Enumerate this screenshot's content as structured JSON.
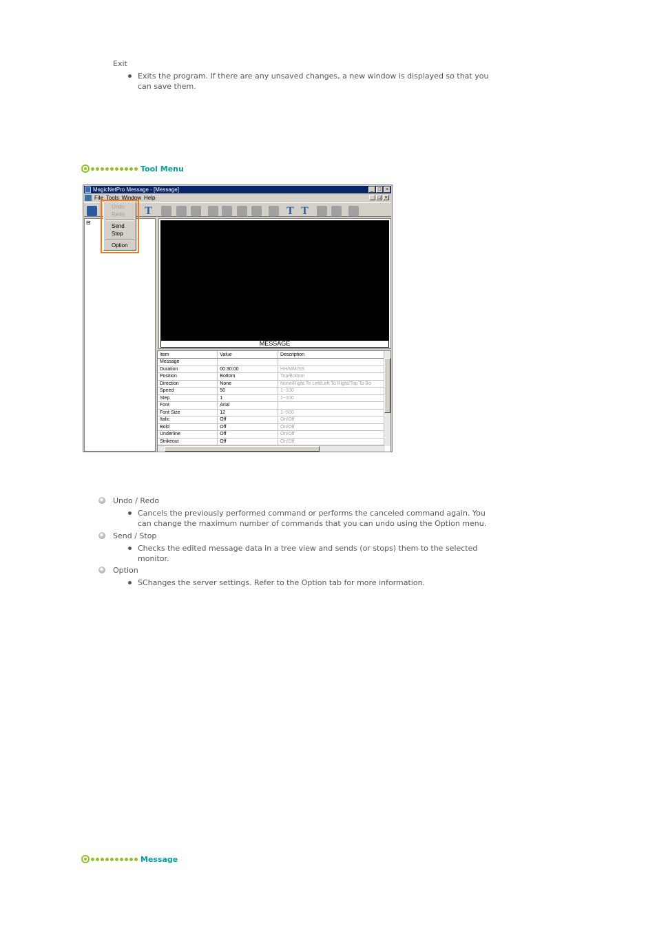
{
  "exit": {
    "term": "Exit",
    "description": "Exits the program. If there are any unsaved changes, a new window is displayed so that you can save them."
  },
  "sections": {
    "tool_menu": "Tool Menu",
    "message": "Message"
  },
  "screenshot": {
    "window_title": "MagicNetPro Message - [Message]",
    "menu": [
      "File",
      "Tools",
      "Window",
      "Help"
    ],
    "tools_dropdown": [
      "Undo",
      "Redo",
      "Send",
      "Stop",
      "Option"
    ],
    "preview_label": "MESSAGE",
    "grid_headers": [
      "Item",
      "Value",
      "Description"
    ],
    "grid_rows": [
      [
        "Message",
        "",
        ""
      ],
      [
        "Duration",
        "00:30:00",
        "HH/MM/SS"
      ],
      [
        "Position",
        "Bottom",
        "Top/Bottom"
      ],
      [
        "Direction",
        "None",
        "None/Right To Left/Left To Right/Top To Bo"
      ],
      [
        "Speed",
        "50",
        "1~100"
      ],
      [
        "Step",
        "1",
        "1~100"
      ],
      [
        "Font",
        "Arial",
        ""
      ],
      [
        "Font Size",
        "12",
        "1~500"
      ],
      [
        "Italic",
        "Off",
        "On/Off"
      ],
      [
        "Bold",
        "Off",
        "On/Off"
      ],
      [
        "Underline",
        "Off",
        "On/Off"
      ],
      [
        "Strikeout",
        "Off",
        "On/Off"
      ]
    ]
  },
  "items": [
    {
      "term": "Undo / Redo",
      "description": "Cancels the previously performed command or performs the canceled command again. You can change the maximum number of commands that you can undo using the Option menu."
    },
    {
      "term": "Send / Stop",
      "description": "Checks the edited message data in a tree view and sends (or stops) them to the selected monitor."
    },
    {
      "term": "Option",
      "description": "SChanges the server settings. Refer to the Option tab for more information."
    }
  ],
  "colors": {
    "section_title": "#00a398",
    "section_dots": "#8dc21f",
    "highlight": "#f07a1e"
  }
}
